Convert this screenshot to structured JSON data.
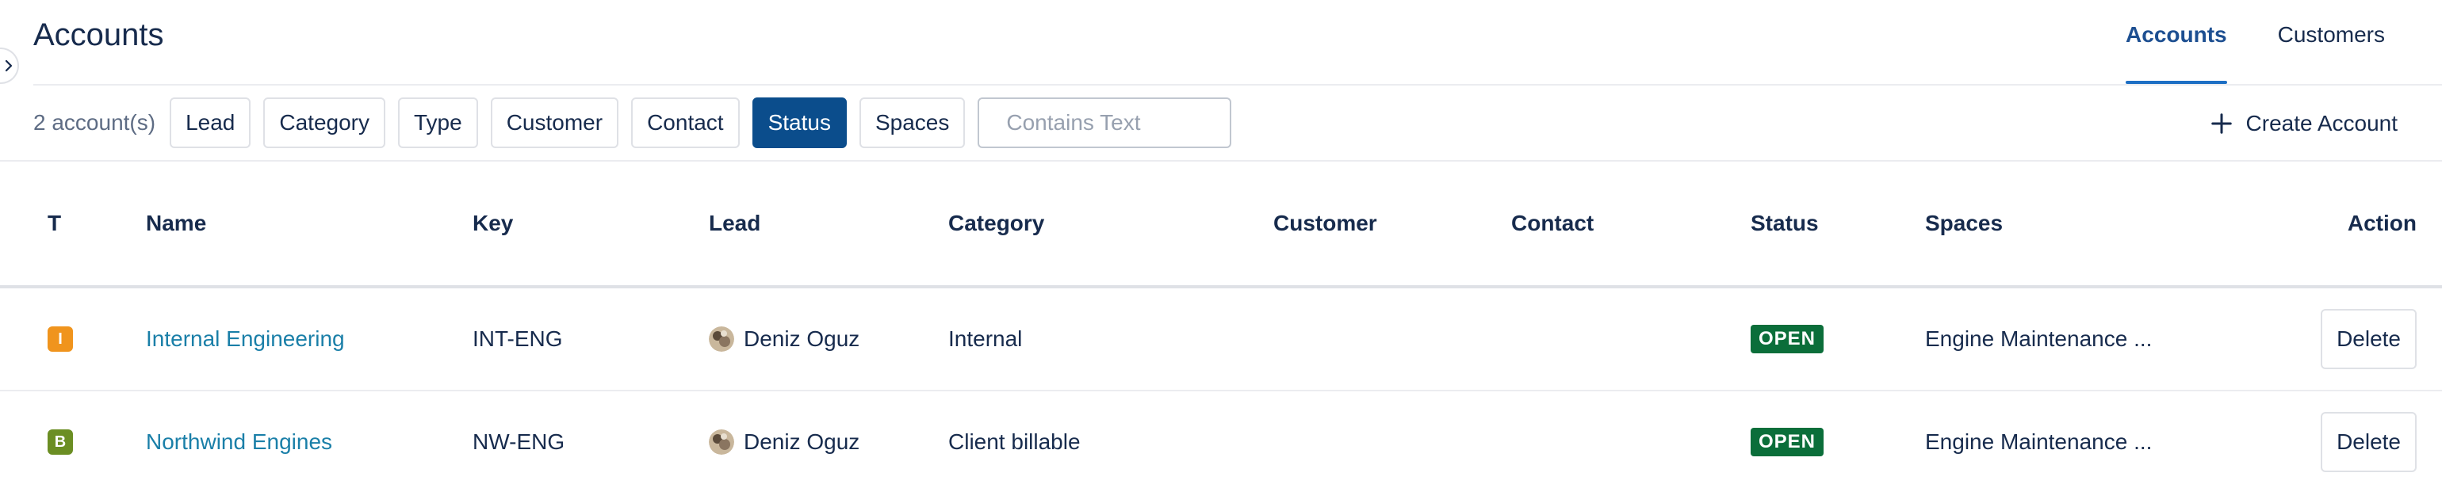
{
  "header": {
    "title": "Accounts",
    "tabs": [
      {
        "label": "Accounts",
        "active": true
      },
      {
        "label": "Customers",
        "active": false
      }
    ]
  },
  "filters": {
    "count_label": "2 account(s)",
    "chips": [
      {
        "label": "Lead",
        "selected": false
      },
      {
        "label": "Category",
        "selected": false
      },
      {
        "label": "Type",
        "selected": false
      },
      {
        "label": "Customer",
        "selected": false
      },
      {
        "label": "Contact",
        "selected": false
      },
      {
        "label": "Status",
        "selected": true
      },
      {
        "label": "Spaces",
        "selected": false
      }
    ],
    "search_placeholder": "Contains Text",
    "search_value": "",
    "create_label": "Create Account"
  },
  "table": {
    "columns": [
      "T",
      "Name",
      "Key",
      "Lead",
      "Category",
      "Customer",
      "Contact",
      "Status",
      "Spaces",
      "Action"
    ],
    "rows": [
      {
        "type_letter": "I",
        "type_color": "#f0941d",
        "name": "Internal Engineering",
        "key": "INT-ENG",
        "lead": "Deniz Oguz",
        "category": "Internal",
        "customer": "",
        "contact": "",
        "status": "OPEN",
        "spaces": "Engine Maintenance ...",
        "action": "Delete"
      },
      {
        "type_letter": "B",
        "type_color": "#6b8e23",
        "name": "Northwind Engines",
        "key": "NW-ENG",
        "lead": "Deniz Oguz",
        "category": "Client billable",
        "customer": "",
        "contact": "",
        "status": "OPEN",
        "spaces": "Engine Maintenance ...",
        "action": "Delete"
      }
    ]
  },
  "colors": {
    "accent": "#0b4d8c",
    "link": "#1a7fa8",
    "status_open": "#0b6e3a"
  },
  "icons": {
    "sidebar_toggle": "chevron-right-icon",
    "create": "plus-icon",
    "avatar": "avatar-icon"
  }
}
